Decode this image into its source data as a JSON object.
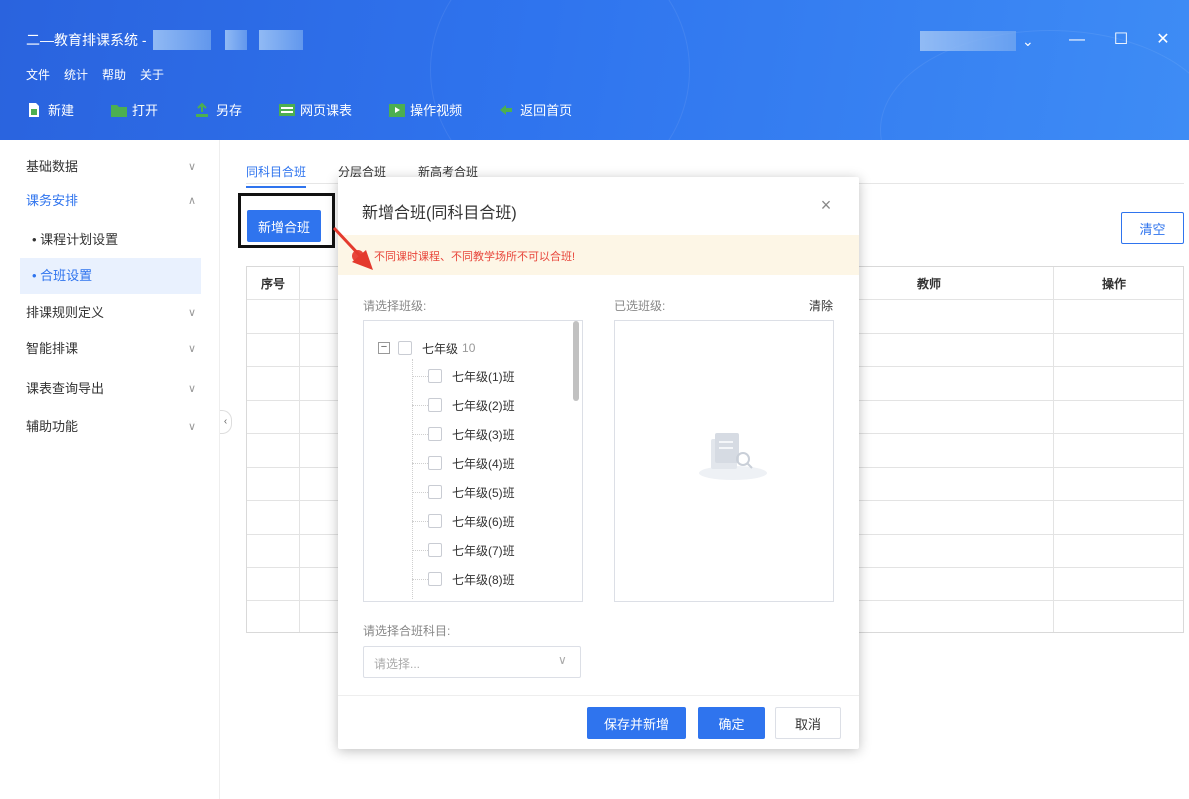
{
  "window": {
    "title": "二—教育排课系统 -",
    "controls": {
      "minimize": "—",
      "maximize": "☐",
      "close": "✕"
    },
    "user_chevron": "⌄"
  },
  "menu": [
    "文件",
    "统计",
    "帮助",
    "关于"
  ],
  "toolbar": [
    {
      "label": "新建",
      "icon": "new-file-icon"
    },
    {
      "label": "打开",
      "icon": "folder-icon"
    },
    {
      "label": "另存",
      "icon": "save-as-icon"
    },
    {
      "label": "网页课表",
      "icon": "web-schedule-icon"
    },
    {
      "label": "操作视频",
      "icon": "video-icon"
    },
    {
      "label": "返回首页",
      "icon": "back-arrow-icon"
    }
  ],
  "sidebar": {
    "items": [
      {
        "label": "基础数据",
        "chevron": "∨"
      },
      {
        "label": "课务安排",
        "chevron": "∧"
      },
      {
        "label": "排课规则定义",
        "chevron": "∨"
      },
      {
        "label": "智能排课",
        "chevron": "∨"
      },
      {
        "label": "课表查询导出",
        "chevron": "∨"
      },
      {
        "label": "辅助功能",
        "chevron": "∨"
      }
    ],
    "sub_items": [
      "• 课程计划设置",
      "• 合班设置"
    ],
    "collapse": "‹"
  },
  "tabs": [
    "同科目合班",
    "分层合班",
    "新高考合班"
  ],
  "actions": {
    "add": "新增合班",
    "clear": "清空"
  },
  "table": {
    "headers": [
      "序号",
      "教师",
      "操作"
    ]
  },
  "dialog": {
    "title": "新增合班(同科目合班)",
    "close": "×",
    "warning": "不同课时课程、不同教学场所不可以合班!",
    "select_class_label": "请选择班级:",
    "selected_class_label": "已选班级:",
    "clear_label": "清除",
    "tree": {
      "parent": {
        "label": "七年级",
        "count": "10",
        "toggle": "−"
      },
      "children": [
        "七年级(1)班",
        "七年级(2)班",
        "七年级(3)班",
        "七年级(4)班",
        "七年级(5)班",
        "七年级(6)班",
        "七年级(7)班",
        "七年级(8)班"
      ]
    },
    "subject_label": "请选择合班科目:",
    "subject_placeholder": "请选择...",
    "subject_chevron": "∨",
    "buttons": {
      "save_new": "保存并新增",
      "confirm": "确定",
      "cancel": "取消"
    }
  },
  "colors": {
    "primary": "#2f74ee",
    "warning": "#e8463b",
    "warning_bg": "#fdf6e6",
    "arrow": "#e43a2e"
  }
}
